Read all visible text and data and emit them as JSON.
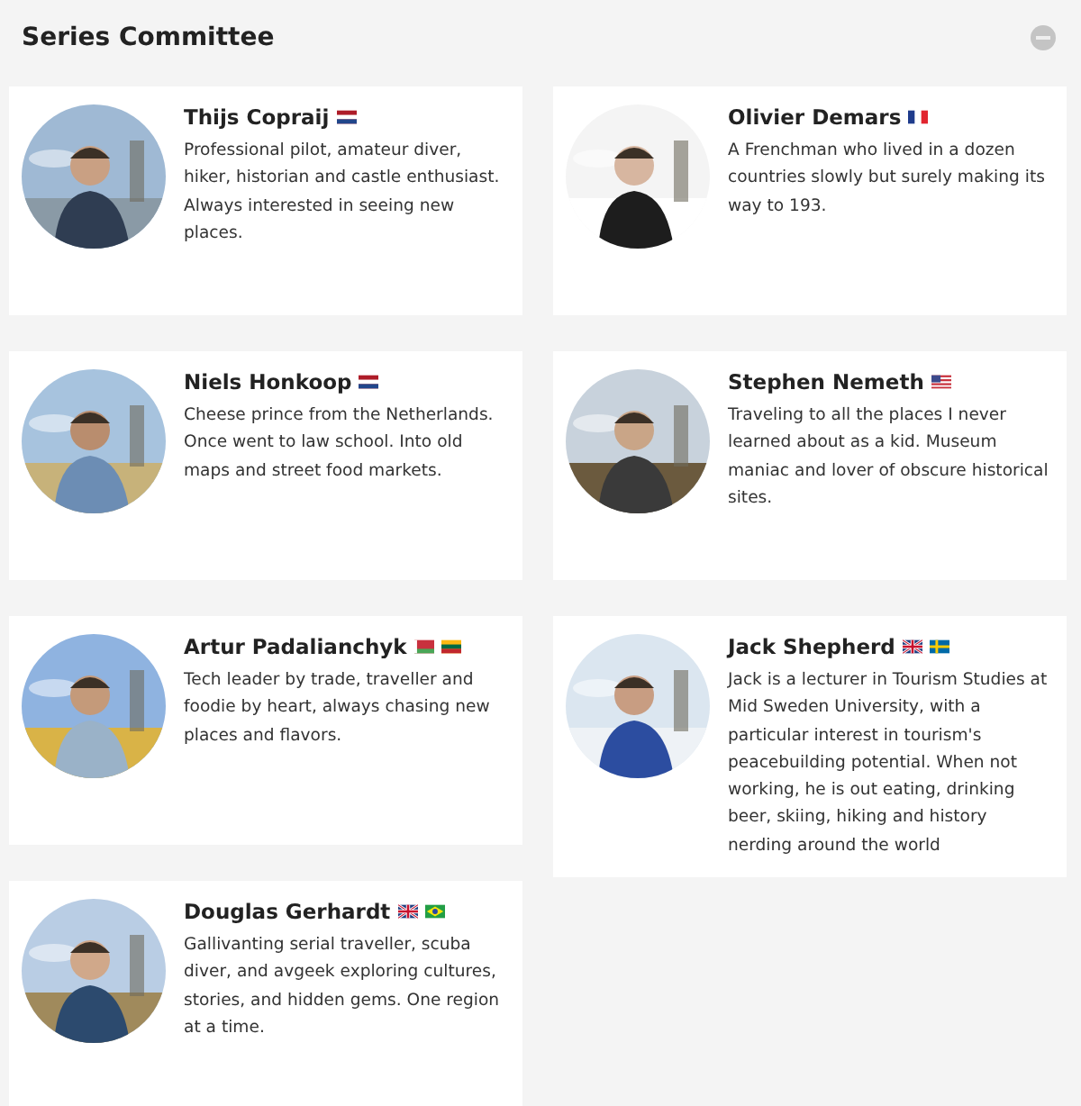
{
  "section": {
    "title": "Series Committee",
    "collapsed": false
  },
  "columns": [
    [
      {
        "name": "Thijs Copraij",
        "flags": [
          {
            "kind": "netherlands"
          }
        ],
        "bio": "Professional pilot, amateur diver, hiker, historian and castle enthusiast. Always interested in seeing new places."
      },
      {
        "name": "Niels Honkoop",
        "flags": [
          {
            "kind": "netherlands"
          }
        ],
        "bio": " Cheese prince from the Netherlands. Once went to law school. Into old maps and street food markets."
      },
      {
        "name": "Artur Padalianchyk",
        "flags": [
          {
            "kind": "belarus"
          },
          {
            "kind": "lithuania"
          }
        ],
        "bio": "Tech leader by trade, traveller and foodie by heart, always chasing new places and flavors."
      },
      {
        "name": "Douglas Gerhardt",
        "flags": [
          {
            "kind": "uk"
          },
          {
            "kind": "brazil"
          }
        ],
        "bio": "Gallivanting serial traveller, scuba diver, and avgeek exploring cultures, stories, and hidden gems. One region at a time."
      }
    ],
    [
      {
        "name": "Olivier Demars",
        "flags": [
          {
            "kind": "france"
          }
        ],
        "bio": "A Frenchman who lived in a dozen countries slowly but surely making its way to 193."
      },
      {
        "name": "Stephen Nemeth",
        "flags": [
          {
            "kind": "usa"
          }
        ],
        "bio": "Traveling to all the places I never learned about as a kid. Museum maniac and lover of obscure historical sites."
      },
      {
        "name": "Jack Shepherd",
        "flags": [
          {
            "kind": "uk"
          },
          {
            "kind": "sweden"
          }
        ],
        "bio": "Jack is a lecturer in Tourism Studies at Mid Sweden University, with a particular interest in tourism's peacebuilding potential. When not working, he is out eating, drinking beer, skiing, hiking and history nerding around the world"
      }
    ]
  ]
}
